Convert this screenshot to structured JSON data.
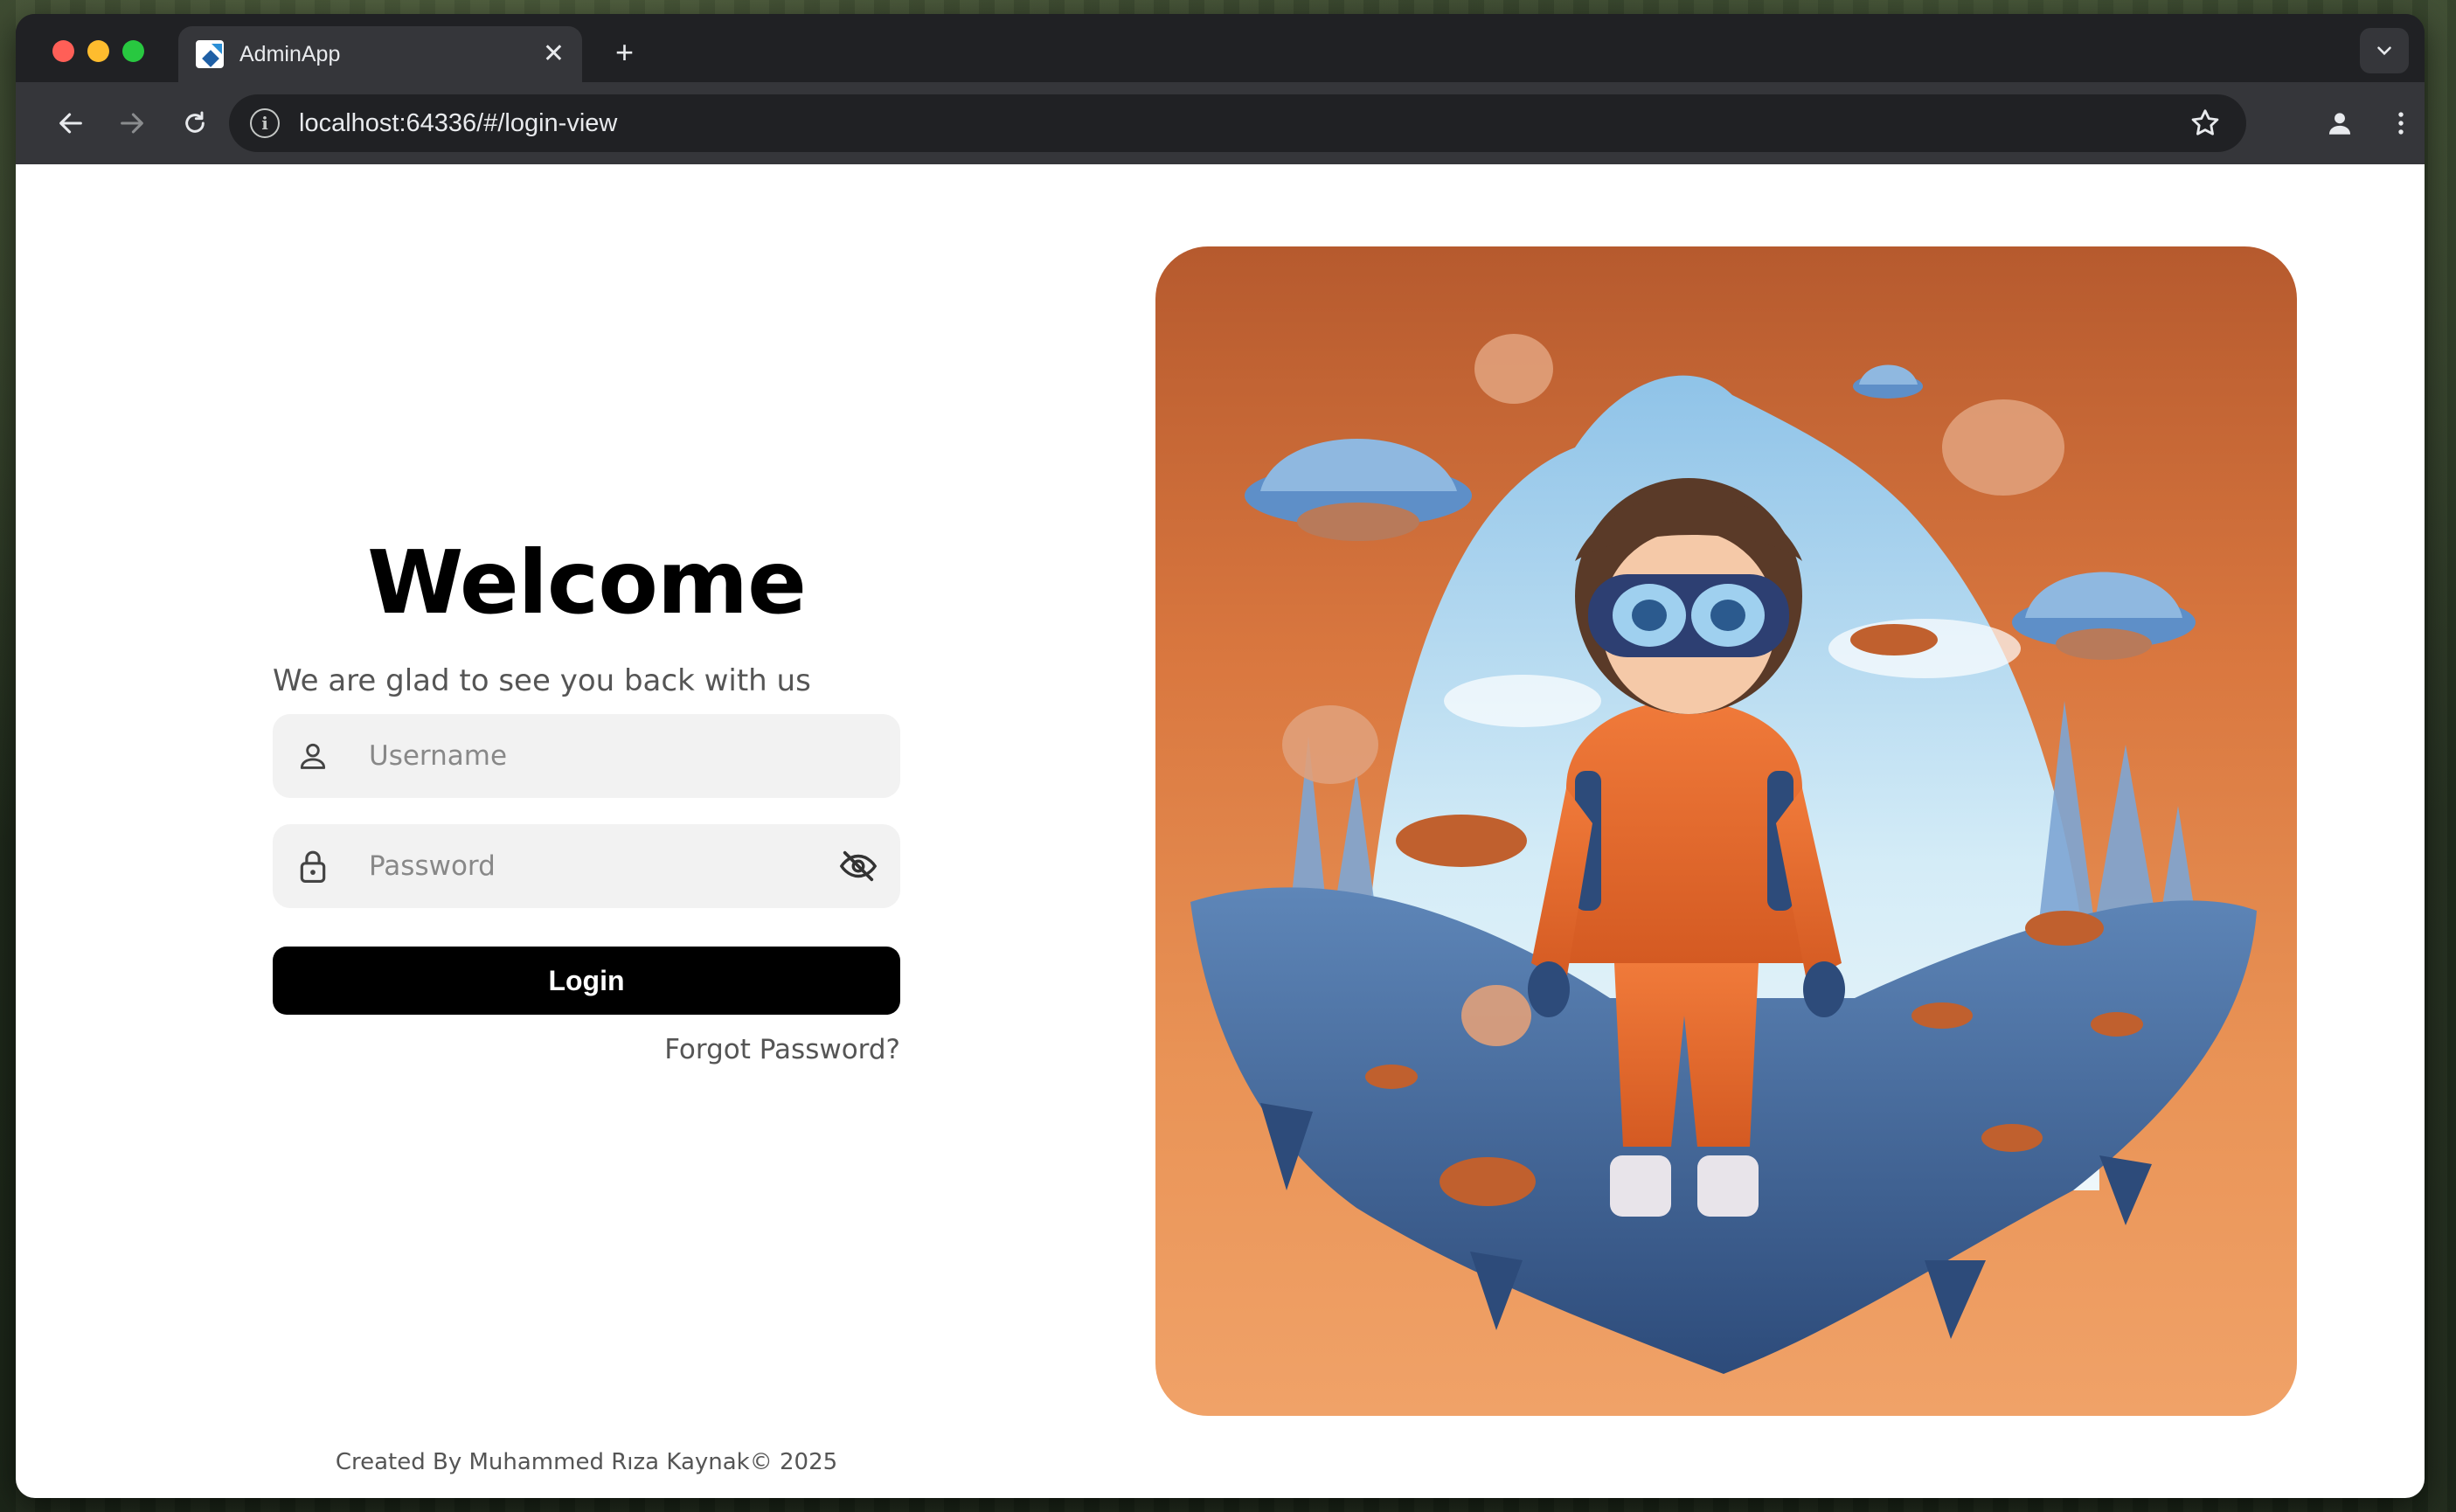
{
  "browser": {
    "tab": {
      "title": "AdminApp",
      "close_glyph": "✕"
    },
    "new_tab_glyph": "+",
    "url": "localhost:64336/#/login-view",
    "icons": [
      "back-arrow-icon",
      "forward-arrow-icon",
      "reload-icon",
      "site-info-icon",
      "bookmark-star-icon",
      "profile-icon",
      "kebab-menu-icon",
      "tab-search-chevron-icon"
    ]
  },
  "login": {
    "title": "Welcome",
    "subtitle": "We are glad to see you back with us",
    "username": {
      "placeholder": "Username",
      "value": ""
    },
    "password": {
      "placeholder": "Password",
      "value": ""
    },
    "login_label": "Login",
    "forgot_label": "Forgot Password?"
  },
  "footer": {
    "text": "Created By Muhammed Rıza Kaynak© 2025"
  },
  "colors": {
    "button_bg": "#000000",
    "field_bg": "#f2f2f2",
    "hero_top": "#b65a2e",
    "hero_bottom": "#f0a268"
  }
}
